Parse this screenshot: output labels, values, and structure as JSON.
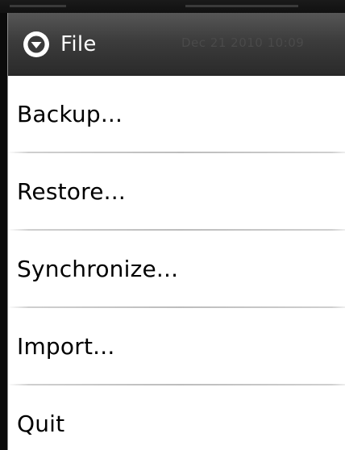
{
  "dialog": {
    "title": "File",
    "title_icon": "chevron-down-circle-icon",
    "title_bg_text": "Dec 21 2010 10:09"
  },
  "menu": {
    "items": [
      {
        "label": "Backup..."
      },
      {
        "label": "Restore..."
      },
      {
        "label": "Synchronize..."
      },
      {
        "label": "Import..."
      },
      {
        "label": "Quit"
      }
    ]
  },
  "colors": {
    "title_bar": "#3c3c3c",
    "title_text": "#ffffff",
    "menu_bg": "#ffffff",
    "menu_text": "#000000",
    "divider": "#bdbdbd"
  }
}
